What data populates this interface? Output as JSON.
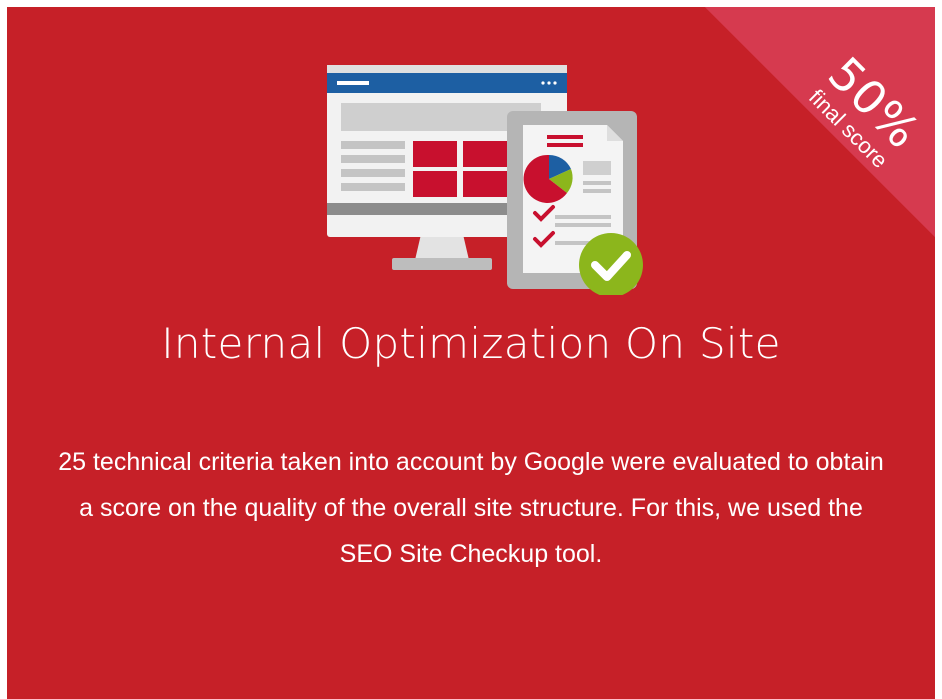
{
  "ribbon": {
    "score": "50%",
    "label": "final score",
    "color": "#d63a4f"
  },
  "card": {
    "background": "#c62028"
  },
  "illustration": {
    "icon": "seo-audit-monitor-report-checkmark-icon"
  },
  "title": "Internal Optimization On Site",
  "description": "25 technical criteria taken into account by Google were evaluated to obtain a score on the quality of the overall site structure. For this, we used the SEO Site Checkup tool."
}
